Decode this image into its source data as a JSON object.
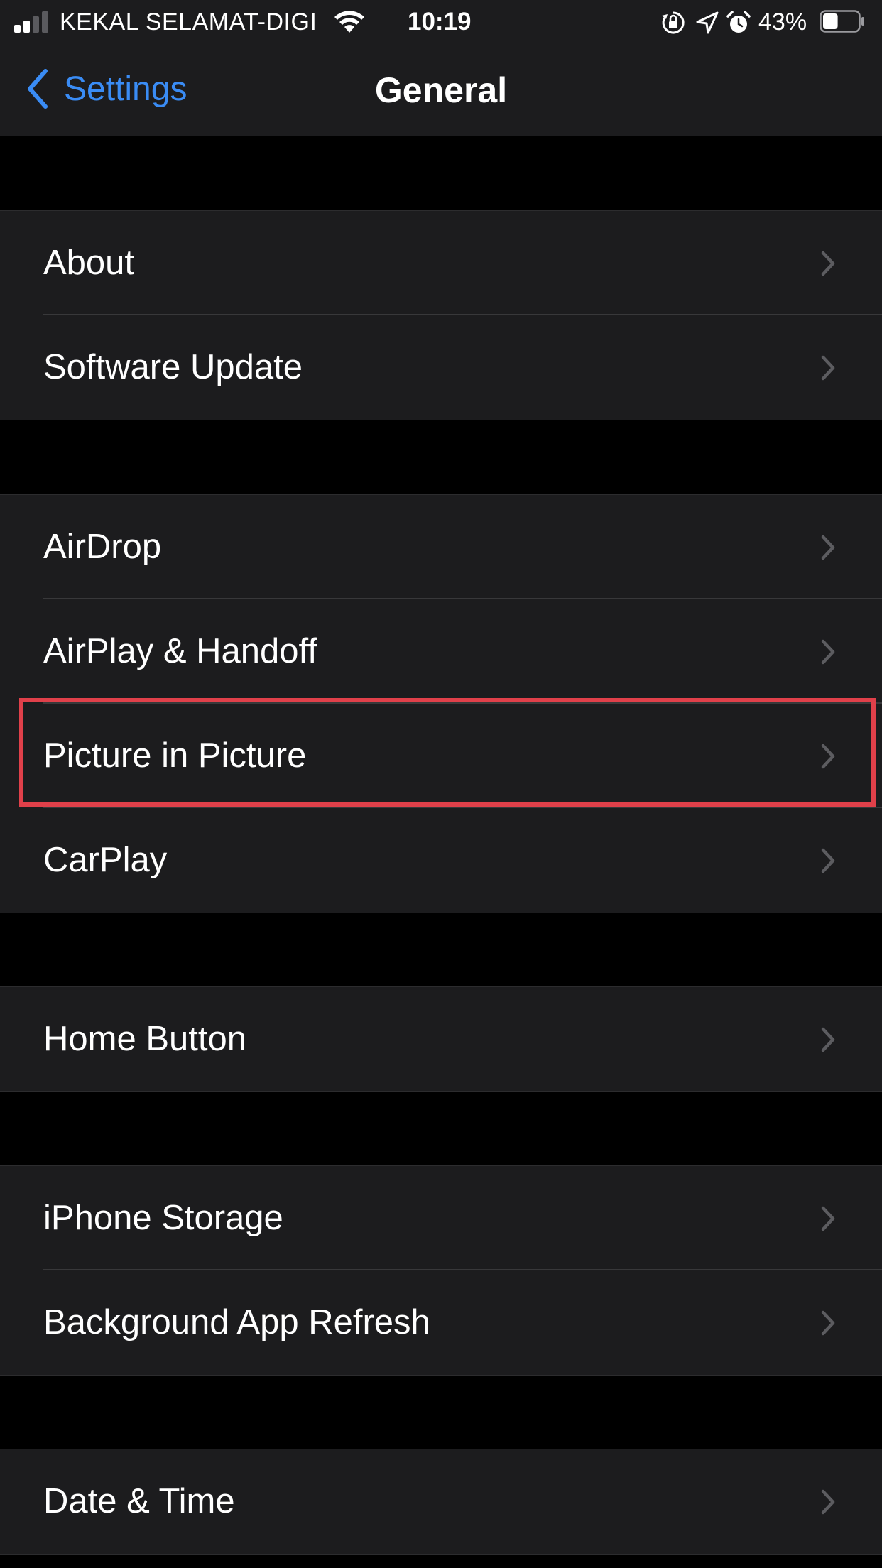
{
  "status_bar": {
    "carrier": "KEKAL SELAMAT-DIGI",
    "time": "10:19",
    "battery_percent": "43%",
    "battery_level": 0.43,
    "signal_bars_active": 2,
    "signal_bars_total": 4,
    "icons": [
      "signal-icon",
      "wifi-icon",
      "orientation-lock-icon",
      "location-icon",
      "alarm-icon",
      "battery-icon"
    ]
  },
  "nav": {
    "back_label": "Settings",
    "title": "General"
  },
  "groups": [
    {
      "items": [
        {
          "label": "About"
        },
        {
          "label": "Software Update"
        }
      ]
    },
    {
      "items": [
        {
          "label": "AirDrop"
        },
        {
          "label": "AirPlay & Handoff"
        },
        {
          "label": "Picture in Picture"
        },
        {
          "label": "CarPlay"
        }
      ]
    },
    {
      "items": [
        {
          "label": "Home Button"
        }
      ]
    },
    {
      "items": [
        {
          "label": "iPhone Storage"
        },
        {
          "label": "Background App Refresh"
        }
      ]
    },
    {
      "items": [
        {
          "label": "Date & Time"
        }
      ]
    }
  ],
  "colors": {
    "background": "#000000",
    "cell": "#1c1c1e",
    "accent_blue": "#3a8cf5",
    "highlight_red": "#e0404a",
    "chevron": "#5c5c60"
  }
}
